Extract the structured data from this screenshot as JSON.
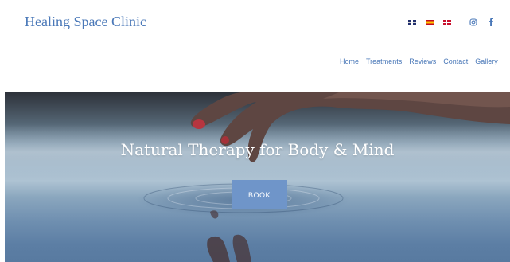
{
  "header": {
    "brand": "Healing Space Clinic",
    "languages": [
      {
        "name": "english-flag-icon"
      },
      {
        "name": "spanish-flag-icon"
      },
      {
        "name": "danish-flag-icon"
      }
    ],
    "social": [
      {
        "name": "instagram-icon"
      },
      {
        "name": "facebook-icon"
      }
    ],
    "nav": [
      {
        "label": "Home"
      },
      {
        "label": "Treatments"
      },
      {
        "label": "Reviews"
      },
      {
        "label": "Contact"
      },
      {
        "label": "Gallery"
      }
    ]
  },
  "hero": {
    "title": "Natural Therapy for Body & Mind",
    "button": "BOOK"
  },
  "colors": {
    "brand": "#4a78b8",
    "button": "#6f95c9"
  }
}
